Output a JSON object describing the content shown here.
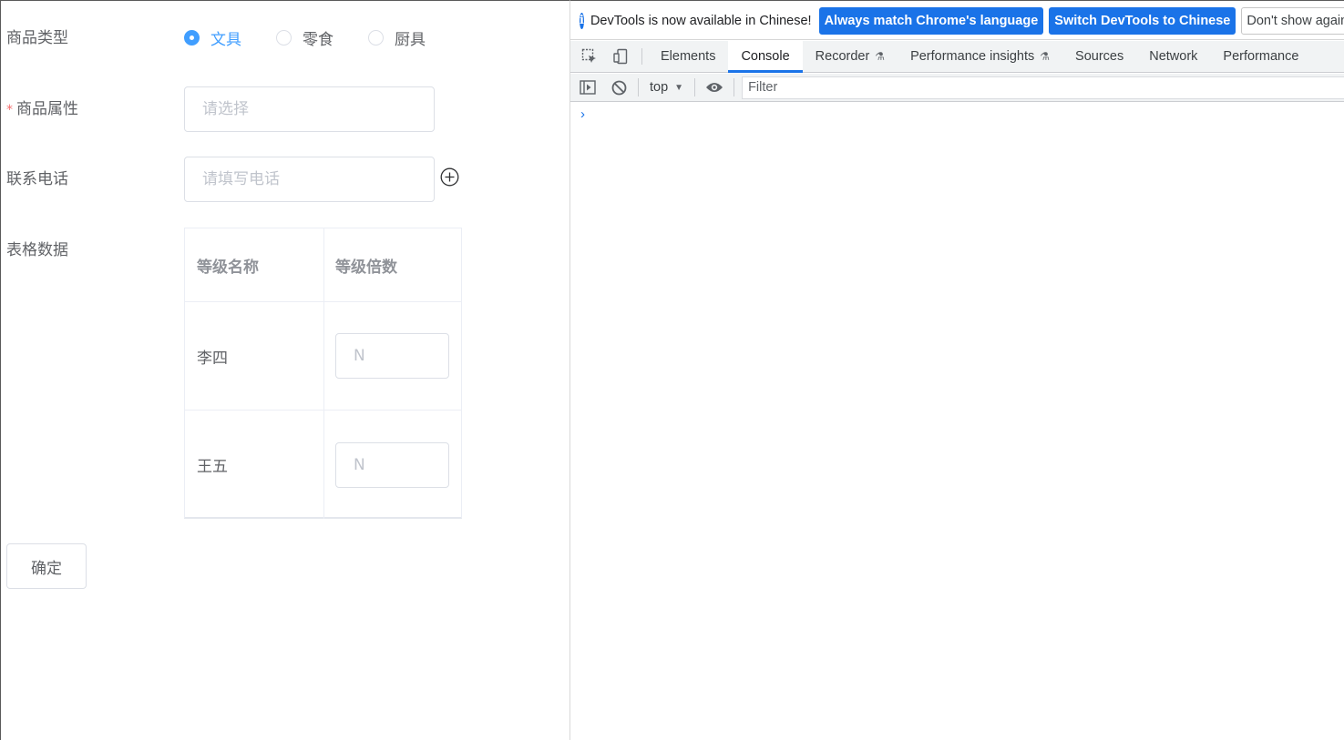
{
  "form": {
    "product_type": {
      "label": "商品类型",
      "options": [
        {
          "label": "文具",
          "checked": true
        },
        {
          "label": "零食",
          "checked": false
        },
        {
          "label": "厨具",
          "checked": false
        }
      ]
    },
    "product_attr": {
      "required_mark": "*",
      "label": "商品属性",
      "placeholder": "请选择"
    },
    "phone": {
      "label": "联系电话",
      "placeholder": "请填写电话"
    },
    "table": {
      "label": "表格数据",
      "headers": [
        "等级名称",
        "等级倍数"
      ],
      "rows": [
        {
          "name": "李四",
          "multiplier_placeholder": "N"
        },
        {
          "name": "王五",
          "multiplier_placeholder": "N"
        }
      ]
    },
    "confirm_label": "确定"
  },
  "devtools": {
    "infobar": {
      "message": "DevTools is now available in Chinese!",
      "btn_match": "Always match Chrome's language",
      "btn_switch": "Switch DevTools to Chinese",
      "btn_dismiss": "Don't show again"
    },
    "tabs": [
      "Elements",
      "Console",
      "Recorder",
      "Performance insights",
      "Sources",
      "Network",
      "Performance"
    ],
    "active_tab": "Console",
    "context": "top",
    "filter_placeholder": "Filter",
    "prompt": "›",
    "accent_color": "#1a73e8"
  }
}
